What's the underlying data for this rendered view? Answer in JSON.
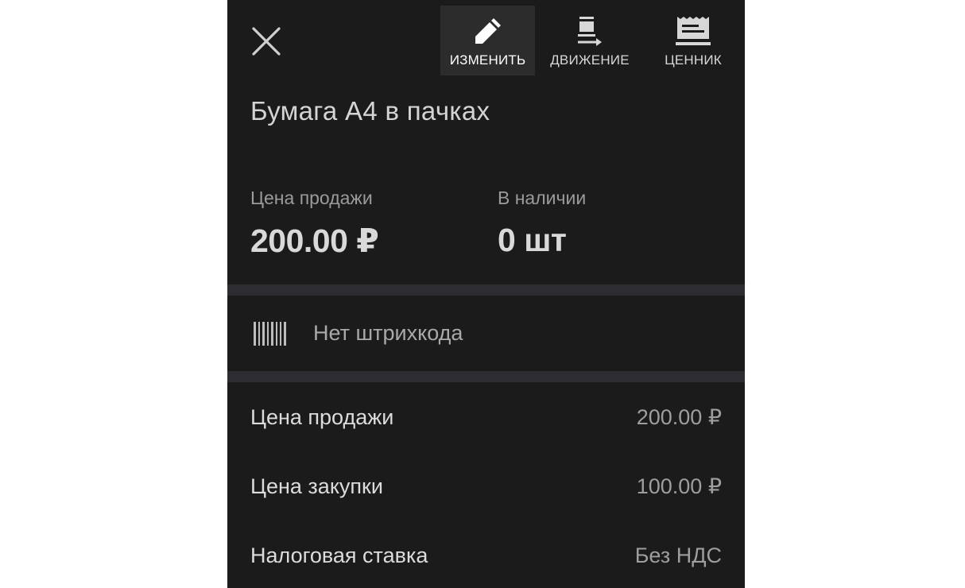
{
  "toolbar": {
    "close_icon": "close-icon",
    "actions": [
      {
        "label": "ИЗМЕНИТЬ",
        "icon": "pencil-icon",
        "active": true
      },
      {
        "label": "ДВИЖЕНИЕ",
        "icon": "stock-movement-icon",
        "active": false
      },
      {
        "label": "ЦЕННИК",
        "icon": "price-tag-print-icon",
        "active": false
      }
    ]
  },
  "product": {
    "name": "Бумага А4 в пачках"
  },
  "summary": {
    "price": {
      "label": "Цена продажи",
      "value": "200.00 ₽"
    },
    "stock": {
      "label": "В наличии",
      "value": "0 шт"
    }
  },
  "barcode": {
    "icon": "barcode-icon",
    "text": "Нет штрихкода"
  },
  "fields": [
    {
      "label": "Цена продажи",
      "value": "200.00 ₽"
    },
    {
      "label": "Цена закупки",
      "value": "100.00 ₽"
    },
    {
      "label": "Налоговая ставка",
      "value": "Без НДС"
    }
  ],
  "colors": {
    "background": "#1b1b1b",
    "active_tool": "#2c2c2c",
    "divider": "#2d2c30",
    "primary_text": "#dcdcdc",
    "secondary_text": "#9e9e9e"
  }
}
